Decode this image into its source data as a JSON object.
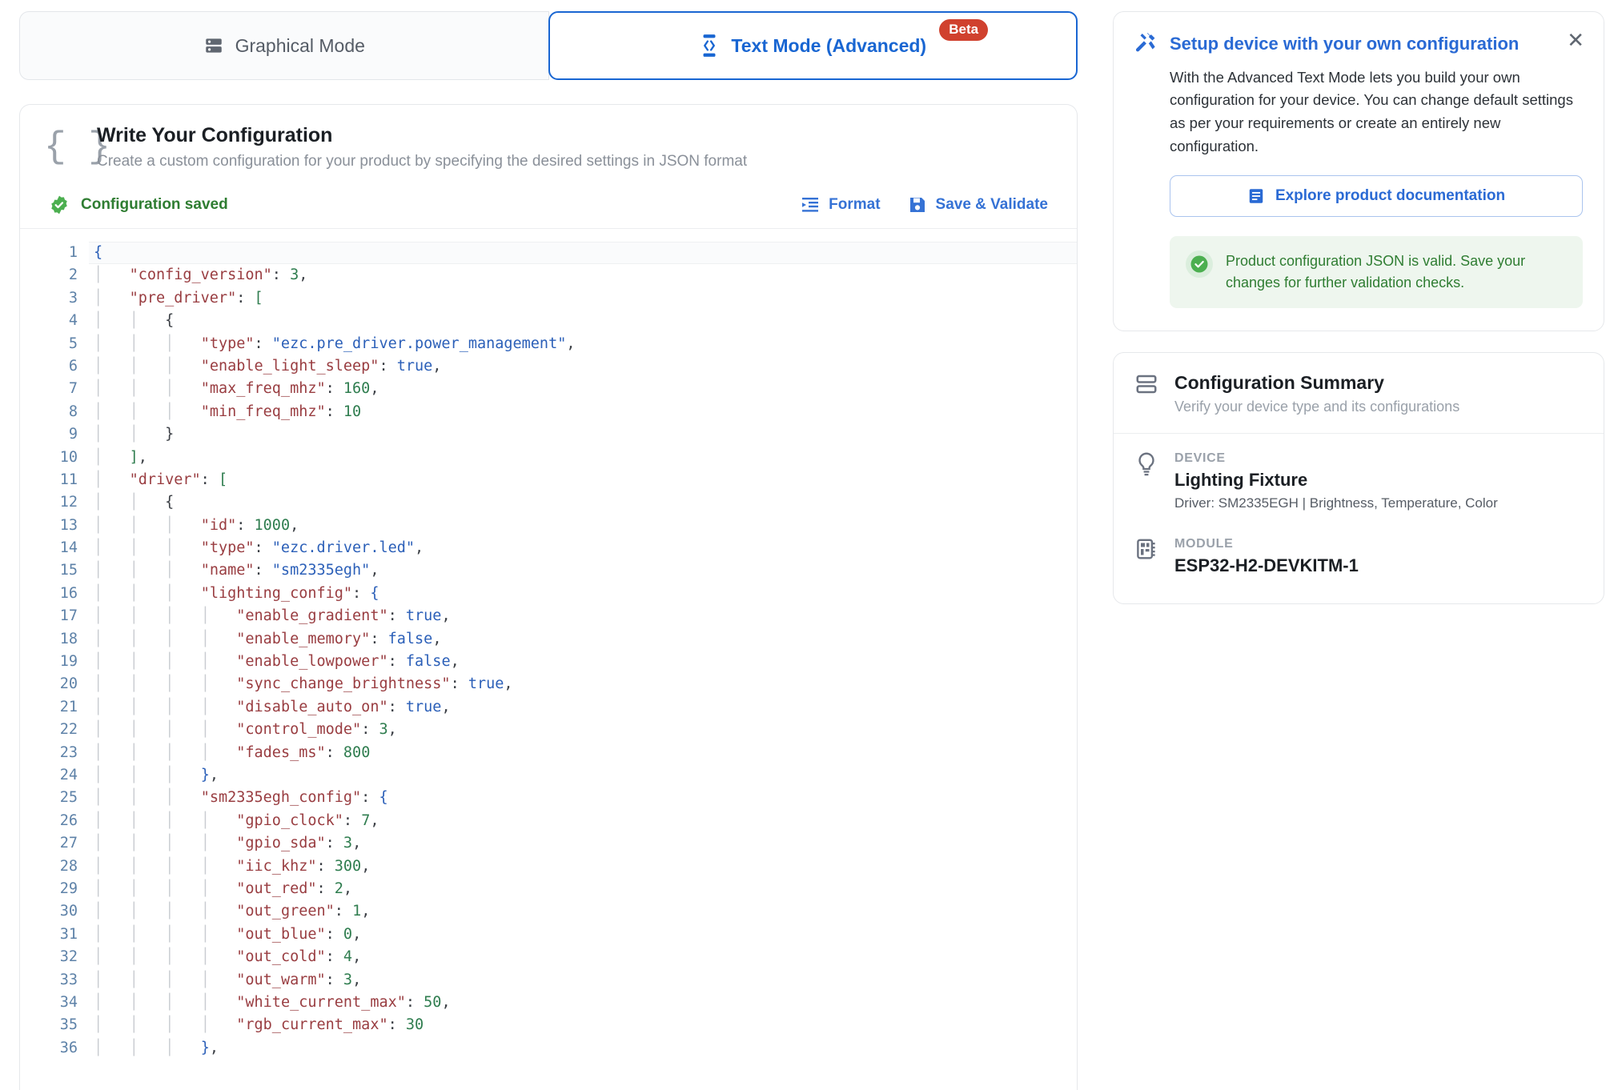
{
  "tabs": [
    {
      "label": "Graphical Mode",
      "icon": "server-rack-icon",
      "active": false,
      "badge": null
    },
    {
      "label": "Text Mode (Advanced)",
      "icon": "code-brackets-icon",
      "active": true,
      "badge": "Beta"
    }
  ],
  "config_card": {
    "icon": "curly-braces-icon",
    "title": "Write Your Configuration",
    "subtitle": "Create a custom configuration for your product by specifying the desired settings in JSON format",
    "status": {
      "text": "Configuration saved",
      "icon": "check-badge-icon",
      "color": "#2f7d32"
    },
    "actions": [
      {
        "label": "Format",
        "icon": "format-indent-icon"
      },
      {
        "label": "Save & Validate",
        "icon": "save-disk-icon"
      }
    ]
  },
  "editor": {
    "first_line": 1,
    "last_visible_line": 36,
    "current_line": 1,
    "lines": [
      {
        "n": 1,
        "tokens": [
          {
            "t": "br",
            "v": "{"
          }
        ]
      },
      {
        "n": 2,
        "tokens": [
          {
            "t": "sp",
            "v": "    "
          },
          {
            "t": "k",
            "v": "\"config_version\""
          },
          {
            "t": "p",
            "v": ": "
          },
          {
            "t": "n",
            "v": "3"
          },
          {
            "t": "p",
            "v": ","
          }
        ]
      },
      {
        "n": 3,
        "tokens": [
          {
            "t": "sp",
            "v": "    "
          },
          {
            "t": "k",
            "v": "\"pre_driver\""
          },
          {
            "t": "p",
            "v": ": "
          },
          {
            "t": "brg",
            "v": "["
          }
        ]
      },
      {
        "n": 4,
        "tokens": [
          {
            "t": "sp",
            "v": "        "
          },
          {
            "t": "p",
            "v": "{"
          }
        ]
      },
      {
        "n": 5,
        "tokens": [
          {
            "t": "sp",
            "v": "            "
          },
          {
            "t": "k",
            "v": "\"type\""
          },
          {
            "t": "p",
            "v": ": "
          },
          {
            "t": "s",
            "v": "\"ezc.pre_driver.power_management\""
          },
          {
            "t": "p",
            "v": ","
          }
        ]
      },
      {
        "n": 6,
        "tokens": [
          {
            "t": "sp",
            "v": "            "
          },
          {
            "t": "k",
            "v": "\"enable_light_sleep\""
          },
          {
            "t": "p",
            "v": ": "
          },
          {
            "t": "b",
            "v": "true"
          },
          {
            "t": "p",
            "v": ","
          }
        ]
      },
      {
        "n": 7,
        "tokens": [
          {
            "t": "sp",
            "v": "            "
          },
          {
            "t": "k",
            "v": "\"max_freq_mhz\""
          },
          {
            "t": "p",
            "v": ": "
          },
          {
            "t": "n",
            "v": "160"
          },
          {
            "t": "p",
            "v": ","
          }
        ]
      },
      {
        "n": 8,
        "tokens": [
          {
            "t": "sp",
            "v": "            "
          },
          {
            "t": "k",
            "v": "\"min_freq_mhz\""
          },
          {
            "t": "p",
            "v": ": "
          },
          {
            "t": "n",
            "v": "10"
          }
        ]
      },
      {
        "n": 9,
        "tokens": [
          {
            "t": "sp",
            "v": "        "
          },
          {
            "t": "p",
            "v": "}"
          }
        ]
      },
      {
        "n": 10,
        "tokens": [
          {
            "t": "sp",
            "v": "    "
          },
          {
            "t": "brg",
            "v": "]"
          },
          {
            "t": "p",
            "v": ","
          }
        ]
      },
      {
        "n": 11,
        "tokens": [
          {
            "t": "sp",
            "v": "    "
          },
          {
            "t": "k",
            "v": "\"driver\""
          },
          {
            "t": "p",
            "v": ": "
          },
          {
            "t": "brg",
            "v": "["
          }
        ]
      },
      {
        "n": 12,
        "tokens": [
          {
            "t": "sp",
            "v": "        "
          },
          {
            "t": "p",
            "v": "{"
          }
        ]
      },
      {
        "n": 13,
        "tokens": [
          {
            "t": "sp",
            "v": "            "
          },
          {
            "t": "k",
            "v": "\"id\""
          },
          {
            "t": "p",
            "v": ": "
          },
          {
            "t": "n",
            "v": "1000"
          },
          {
            "t": "p",
            "v": ","
          }
        ]
      },
      {
        "n": 14,
        "tokens": [
          {
            "t": "sp",
            "v": "            "
          },
          {
            "t": "k",
            "v": "\"type\""
          },
          {
            "t": "p",
            "v": ": "
          },
          {
            "t": "s",
            "v": "\"ezc.driver.led\""
          },
          {
            "t": "p",
            "v": ","
          }
        ]
      },
      {
        "n": 15,
        "tokens": [
          {
            "t": "sp",
            "v": "            "
          },
          {
            "t": "k",
            "v": "\"name\""
          },
          {
            "t": "p",
            "v": ": "
          },
          {
            "t": "s",
            "v": "\"sm2335egh\""
          },
          {
            "t": "p",
            "v": ","
          }
        ]
      },
      {
        "n": 16,
        "tokens": [
          {
            "t": "sp",
            "v": "            "
          },
          {
            "t": "k",
            "v": "\"lighting_config\""
          },
          {
            "t": "p",
            "v": ": "
          },
          {
            "t": "br",
            "v": "{"
          }
        ]
      },
      {
        "n": 17,
        "tokens": [
          {
            "t": "sp",
            "v": "                "
          },
          {
            "t": "k",
            "v": "\"enable_gradient\""
          },
          {
            "t": "p",
            "v": ": "
          },
          {
            "t": "b",
            "v": "true"
          },
          {
            "t": "p",
            "v": ","
          }
        ]
      },
      {
        "n": 18,
        "tokens": [
          {
            "t": "sp",
            "v": "                "
          },
          {
            "t": "k",
            "v": "\"enable_memory\""
          },
          {
            "t": "p",
            "v": ": "
          },
          {
            "t": "b",
            "v": "false"
          },
          {
            "t": "p",
            "v": ","
          }
        ]
      },
      {
        "n": 19,
        "tokens": [
          {
            "t": "sp",
            "v": "                "
          },
          {
            "t": "k",
            "v": "\"enable_lowpower\""
          },
          {
            "t": "p",
            "v": ": "
          },
          {
            "t": "b",
            "v": "false"
          },
          {
            "t": "p",
            "v": ","
          }
        ]
      },
      {
        "n": 20,
        "tokens": [
          {
            "t": "sp",
            "v": "                "
          },
          {
            "t": "k",
            "v": "\"sync_change_brightness\""
          },
          {
            "t": "p",
            "v": ": "
          },
          {
            "t": "b",
            "v": "true"
          },
          {
            "t": "p",
            "v": ","
          }
        ]
      },
      {
        "n": 21,
        "tokens": [
          {
            "t": "sp",
            "v": "                "
          },
          {
            "t": "k",
            "v": "\"disable_auto_on\""
          },
          {
            "t": "p",
            "v": ": "
          },
          {
            "t": "b",
            "v": "true"
          },
          {
            "t": "p",
            "v": ","
          }
        ]
      },
      {
        "n": 22,
        "tokens": [
          {
            "t": "sp",
            "v": "                "
          },
          {
            "t": "k",
            "v": "\"control_mode\""
          },
          {
            "t": "p",
            "v": ": "
          },
          {
            "t": "n",
            "v": "3"
          },
          {
            "t": "p",
            "v": ","
          }
        ]
      },
      {
        "n": 23,
        "tokens": [
          {
            "t": "sp",
            "v": "                "
          },
          {
            "t": "k",
            "v": "\"fades_ms\""
          },
          {
            "t": "p",
            "v": ": "
          },
          {
            "t": "n",
            "v": "800"
          }
        ]
      },
      {
        "n": 24,
        "tokens": [
          {
            "t": "sp",
            "v": "            "
          },
          {
            "t": "br",
            "v": "}"
          },
          {
            "t": "p",
            "v": ","
          }
        ]
      },
      {
        "n": 25,
        "tokens": [
          {
            "t": "sp",
            "v": "            "
          },
          {
            "t": "k",
            "v": "\"sm2335egh_config\""
          },
          {
            "t": "p",
            "v": ": "
          },
          {
            "t": "br",
            "v": "{"
          }
        ]
      },
      {
        "n": 26,
        "tokens": [
          {
            "t": "sp",
            "v": "                "
          },
          {
            "t": "k",
            "v": "\"gpio_clock\""
          },
          {
            "t": "p",
            "v": ": "
          },
          {
            "t": "n",
            "v": "7"
          },
          {
            "t": "p",
            "v": ","
          }
        ]
      },
      {
        "n": 27,
        "tokens": [
          {
            "t": "sp",
            "v": "                "
          },
          {
            "t": "k",
            "v": "\"gpio_sda\""
          },
          {
            "t": "p",
            "v": ": "
          },
          {
            "t": "n",
            "v": "3"
          },
          {
            "t": "p",
            "v": ","
          }
        ]
      },
      {
        "n": 28,
        "tokens": [
          {
            "t": "sp",
            "v": "                "
          },
          {
            "t": "k",
            "v": "\"iic_khz\""
          },
          {
            "t": "p",
            "v": ": "
          },
          {
            "t": "n",
            "v": "300"
          },
          {
            "t": "p",
            "v": ","
          }
        ]
      },
      {
        "n": 29,
        "tokens": [
          {
            "t": "sp",
            "v": "                "
          },
          {
            "t": "k",
            "v": "\"out_red\""
          },
          {
            "t": "p",
            "v": ": "
          },
          {
            "t": "n",
            "v": "2"
          },
          {
            "t": "p",
            "v": ","
          }
        ]
      },
      {
        "n": 30,
        "tokens": [
          {
            "t": "sp",
            "v": "                "
          },
          {
            "t": "k",
            "v": "\"out_green\""
          },
          {
            "t": "p",
            "v": ": "
          },
          {
            "t": "n",
            "v": "1"
          },
          {
            "t": "p",
            "v": ","
          }
        ]
      },
      {
        "n": 31,
        "tokens": [
          {
            "t": "sp",
            "v": "                "
          },
          {
            "t": "k",
            "v": "\"out_blue\""
          },
          {
            "t": "p",
            "v": ": "
          },
          {
            "t": "n",
            "v": "0"
          },
          {
            "t": "p",
            "v": ","
          }
        ]
      },
      {
        "n": 32,
        "tokens": [
          {
            "t": "sp",
            "v": "                "
          },
          {
            "t": "k",
            "v": "\"out_cold\""
          },
          {
            "t": "p",
            "v": ": "
          },
          {
            "t": "n",
            "v": "4"
          },
          {
            "t": "p",
            "v": ","
          }
        ]
      },
      {
        "n": 33,
        "tokens": [
          {
            "t": "sp",
            "v": "                "
          },
          {
            "t": "k",
            "v": "\"out_warm\""
          },
          {
            "t": "p",
            "v": ": "
          },
          {
            "t": "n",
            "v": "3"
          },
          {
            "t": "p",
            "v": ","
          }
        ]
      },
      {
        "n": 34,
        "tokens": [
          {
            "t": "sp",
            "v": "                "
          },
          {
            "t": "k",
            "v": "\"white_current_max\""
          },
          {
            "t": "p",
            "v": ": "
          },
          {
            "t": "n",
            "v": "50"
          },
          {
            "t": "p",
            "v": ","
          }
        ]
      },
      {
        "n": 35,
        "tokens": [
          {
            "t": "sp",
            "v": "                "
          },
          {
            "t": "k",
            "v": "\"rgb_current_max\""
          },
          {
            "t": "p",
            "v": ": "
          },
          {
            "t": "n",
            "v": "30"
          }
        ]
      },
      {
        "n": 36,
        "tokens": [
          {
            "t": "sp",
            "v": "            "
          },
          {
            "t": "br",
            "v": "}"
          },
          {
            "t": "p",
            "v": ","
          }
        ]
      }
    ]
  },
  "setup_panel": {
    "icon": "tools-hammer-wrench-icon",
    "title": "Setup device with your own configuration",
    "body": "With the Advanced Text Mode lets you build your own configuration for your device. You can change default settings as per your requirements or create an entirely new configuration.",
    "close_label": "✕",
    "doc_button": {
      "label": "Explore product documentation",
      "icon": "document-icon"
    },
    "validation": {
      "icon": "check-circle-icon",
      "text": "Product configuration JSON is valid. Save your changes for further validation checks.",
      "color": "#2f7d32",
      "background": "#eef6ee"
    }
  },
  "summary_panel": {
    "icon": "stacked-rows-icon",
    "title": "Configuration Summary",
    "subtitle": "Verify your device type and its configurations",
    "rows": [
      {
        "label": "DEVICE",
        "icon": "lightbulb-icon",
        "value": "Lighting Fixture",
        "meta": "Driver: SM2335EGH | Brightness, Temperature, Color"
      },
      {
        "label": "MODULE",
        "icon": "chip-module-icon",
        "value": "ESP32-H2-DEVKITM-1",
        "meta": ""
      }
    ]
  },
  "colors": {
    "accent": "#1966d2",
    "beta_badge": "#d0412e",
    "success": "#2f7d32",
    "muted": "#9aa1aa"
  }
}
